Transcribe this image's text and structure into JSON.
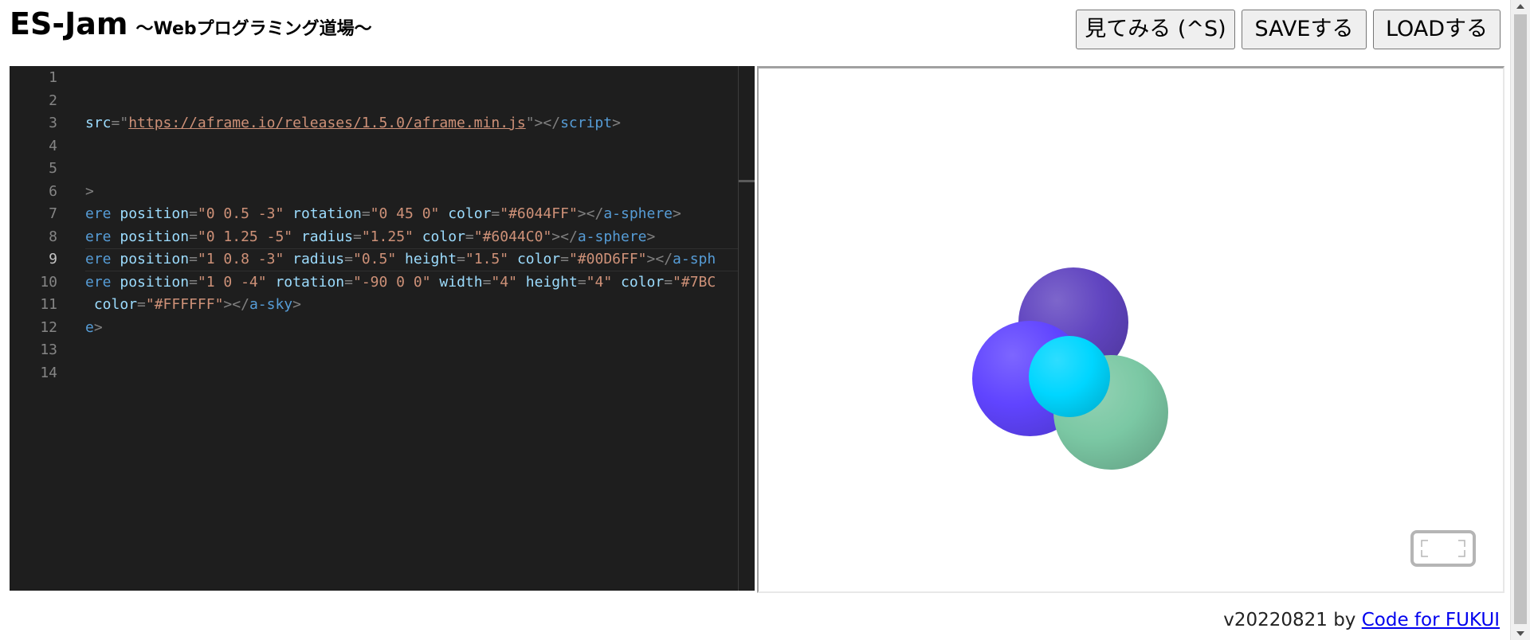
{
  "header": {
    "title": "ES-Jam",
    "subtitle": "～Webプログラミング道場～",
    "buttons": {
      "view": "見てみる (^S)",
      "save": "SAVEする",
      "load": "LOADする"
    }
  },
  "editor": {
    "line_numbers": [
      "1",
      "2",
      "3",
      "4",
      "5",
      "6",
      "7",
      "8",
      "9",
      "10",
      "11",
      "12",
      "13",
      "14"
    ],
    "active_line": "9",
    "lines": [
      [],
      [],
      [
        {
          "t": "src",
          "c": "attr"
        },
        {
          "t": "=\"",
          "c": "punct"
        },
        {
          "t": "https://aframe.io/releases/1.5.0/aframe.min.js",
          "c": "link"
        },
        {
          "t": "\"",
          "c": "punct"
        },
        {
          "t": "></",
          "c": "punct"
        },
        {
          "t": "script",
          "c": "tag"
        },
        {
          "t": ">",
          "c": "punct"
        }
      ],
      [],
      [],
      [
        {
          "t": ">",
          "c": "punct"
        }
      ],
      [
        {
          "t": "ere ",
          "c": "tag"
        },
        {
          "t": "position",
          "c": "attr"
        },
        {
          "t": "=",
          "c": "punct"
        },
        {
          "t": "\"0 0.5 -3\"",
          "c": "str"
        },
        {
          "t": " ",
          "c": "plain"
        },
        {
          "t": "rotation",
          "c": "attr"
        },
        {
          "t": "=",
          "c": "punct"
        },
        {
          "t": "\"0 45 0\"",
          "c": "str"
        },
        {
          "t": " ",
          "c": "plain"
        },
        {
          "t": "color",
          "c": "attr"
        },
        {
          "t": "=",
          "c": "punct"
        },
        {
          "t": "\"#6044FF\"",
          "c": "str"
        },
        {
          "t": "></",
          "c": "punct"
        },
        {
          "t": "a-sphere",
          "c": "tag"
        },
        {
          "t": ">",
          "c": "punct"
        }
      ],
      [
        {
          "t": "ere ",
          "c": "tag"
        },
        {
          "t": "position",
          "c": "attr"
        },
        {
          "t": "=",
          "c": "punct"
        },
        {
          "t": "\"0 1.25 -5\"",
          "c": "str"
        },
        {
          "t": " ",
          "c": "plain"
        },
        {
          "t": "radius",
          "c": "attr"
        },
        {
          "t": "=",
          "c": "punct"
        },
        {
          "t": "\"1.25\"",
          "c": "str"
        },
        {
          "t": " ",
          "c": "plain"
        },
        {
          "t": "color",
          "c": "attr"
        },
        {
          "t": "=",
          "c": "punct"
        },
        {
          "t": "\"#6044C0\"",
          "c": "str"
        },
        {
          "t": "></",
          "c": "punct"
        },
        {
          "t": "a-sphere",
          "c": "tag"
        },
        {
          "t": ">",
          "c": "punct"
        }
      ],
      [
        {
          "t": "ere ",
          "c": "tag"
        },
        {
          "t": "position",
          "c": "attr"
        },
        {
          "t": "=",
          "c": "punct"
        },
        {
          "t": "\"1 0.8 -3\"",
          "c": "str"
        },
        {
          "t": " ",
          "c": "plain"
        },
        {
          "t": "radius",
          "c": "attr"
        },
        {
          "t": "=",
          "c": "punct"
        },
        {
          "t": "\"0.5\"",
          "c": "str"
        },
        {
          "t": " ",
          "c": "plain"
        },
        {
          "t": "height",
          "c": "attr"
        },
        {
          "t": "=",
          "c": "punct"
        },
        {
          "t": "\"1.5\"",
          "c": "str"
        },
        {
          "t": " ",
          "c": "plain"
        },
        {
          "t": "color",
          "c": "attr"
        },
        {
          "t": "=",
          "c": "punct"
        },
        {
          "t": "\"#00D6FF\"",
          "c": "str"
        },
        {
          "t": "></",
          "c": "punct"
        },
        {
          "t": "a-sph",
          "c": "tag"
        }
      ],
      [
        {
          "t": "ere ",
          "c": "tag"
        },
        {
          "t": "position",
          "c": "attr"
        },
        {
          "t": "=",
          "c": "punct"
        },
        {
          "t": "\"1 0 -4\"",
          "c": "str"
        },
        {
          "t": " ",
          "c": "plain"
        },
        {
          "t": "rotation",
          "c": "attr"
        },
        {
          "t": "=",
          "c": "punct"
        },
        {
          "t": "\"-90 0 0\"",
          "c": "str"
        },
        {
          "t": " ",
          "c": "plain"
        },
        {
          "t": "width",
          "c": "attr"
        },
        {
          "t": "=",
          "c": "punct"
        },
        {
          "t": "\"4\"",
          "c": "str"
        },
        {
          "t": " ",
          "c": "plain"
        },
        {
          "t": "height",
          "c": "attr"
        },
        {
          "t": "=",
          "c": "punct"
        },
        {
          "t": "\"4\"",
          "c": "str"
        },
        {
          "t": " ",
          "c": "plain"
        },
        {
          "t": "color",
          "c": "attr"
        },
        {
          "t": "=",
          "c": "punct"
        },
        {
          "t": "\"#7BC",
          "c": "str"
        }
      ],
      [
        {
          "t": " ",
          "c": "plain"
        },
        {
          "t": "color",
          "c": "attr"
        },
        {
          "t": "=",
          "c": "punct"
        },
        {
          "t": "\"#FFFFFF\"",
          "c": "str"
        },
        {
          "t": "></",
          "c": "punct"
        },
        {
          "t": "a-sky",
          "c": "tag"
        },
        {
          "t": ">",
          "c": "punct"
        }
      ],
      [
        {
          "t": "e",
          "c": "tag"
        },
        {
          "t": ">",
          "c": "punct"
        }
      ],
      [],
      []
    ]
  },
  "preview": {
    "spheres": [
      {
        "name": "purple-back-sphere",
        "color": "#6044C0"
      },
      {
        "name": "blue-left-sphere",
        "color": "#6044FF"
      },
      {
        "name": "green-sphere",
        "color": "#7BC8A4"
      },
      {
        "name": "cyan-small-sphere",
        "color": "#00D6FF"
      }
    ],
    "vr_button_icon": "fullscreen-icon"
  },
  "footer": {
    "version": "v20220821 by ",
    "link_text": "Code for FUKUI"
  }
}
